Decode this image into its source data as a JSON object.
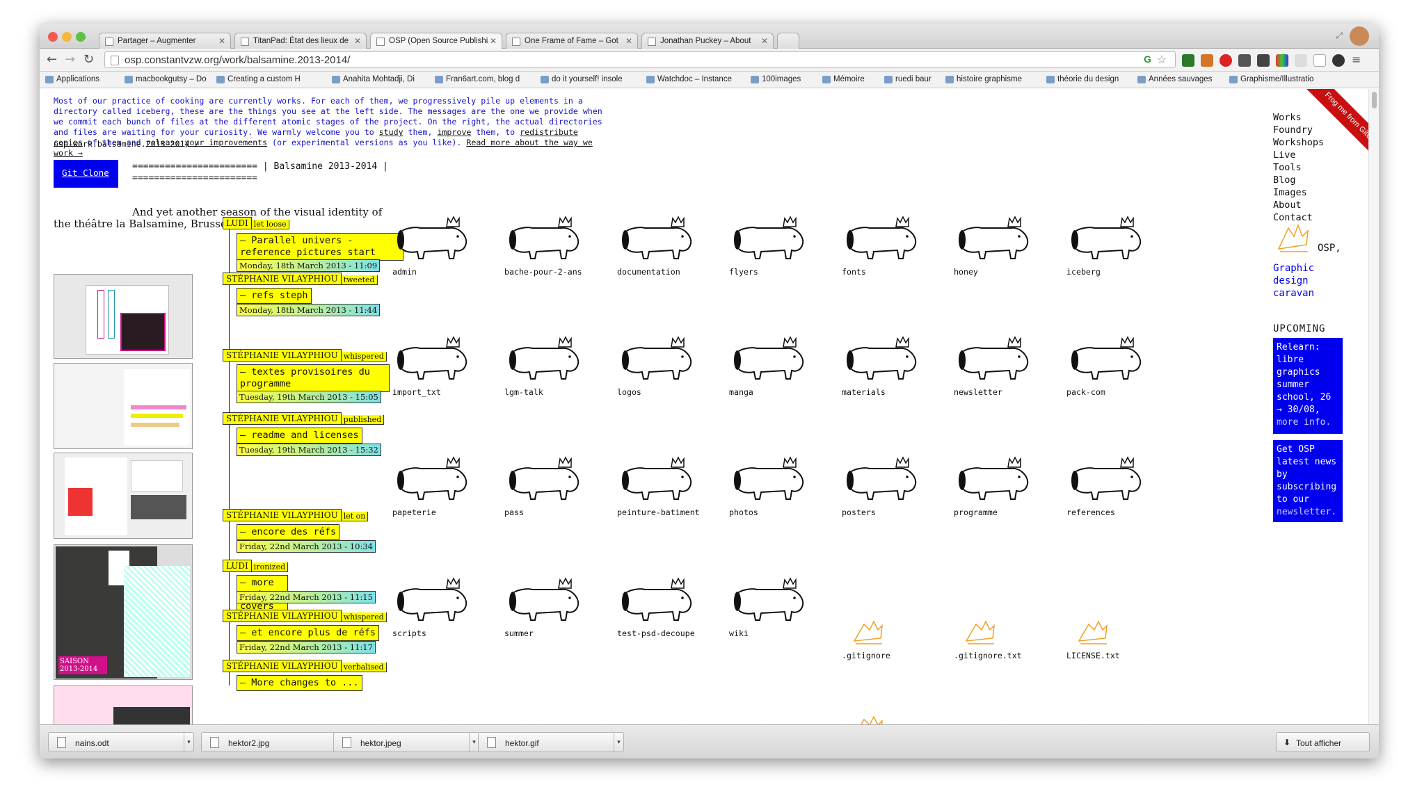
{
  "browser": {
    "tabs": [
      {
        "label": "Partager – Augmenter"
      },
      {
        "label": "TitanPad: État des lieux de"
      },
      {
        "label": "OSP (Open Source Publishi"
      },
      {
        "label": "One Frame of Fame – Got"
      },
      {
        "label": "Jonathan Puckey – About"
      }
    ],
    "url": "osp.constantvzw.org/work/balsamine.2013-2014/",
    "bookmarks": [
      "Applications",
      "macbookgutsy – Do",
      "Creating a custom H",
      "Anahita Mohtadji, Di",
      "Fran6art.com, blog d",
      "do it yourself! insole",
      "Watchdoc – Instance",
      "100images",
      "Mémoire",
      "ruedi baur",
      "histoire graphisme",
      "théorie du design",
      "Années sauvages",
      "Graphisme/Illustratio"
    ]
  },
  "page": {
    "intro_text": "Most of our practice of cooking are currently works. For each of them, we progressively pile up elements in a directory called iceberg, these are the things you see at the left side. The messages are the one we provide when we commit each bunch of files at the different atomic stages of the project. On the right, the actual directories and files are waiting for your curiosity. We warmly welcome you to",
    "link_study": "study",
    "link_improve": "improve",
    "link_redistribute": "redistribute copies",
    "link_release": "release your improvements",
    "intro_tail": "(or experimental versions as you like).",
    "read_more": "Read more about the way we work →",
    "breadcrumb": "osp.work.balsamine.2013-2014 /",
    "git_clone": "Git Clone",
    "rst_rule": "======================= | Balsamine 2013-2014 | =======================",
    "description": "And yet another season of the visual identity of the théâtre la Balsamine, Brussels."
  },
  "commits": [
    {
      "author": "LUDI",
      "action": "let loose",
      "message": "— Parallel univers - reference pictures start",
      "date": "Monday, 18th March 2013 - 11:09"
    },
    {
      "author": "STÉPHANIE VILAYPHIOU",
      "action": "tweeted",
      "message": "— refs steph",
      "date": "Monday, 18th March 2013 - 11:44"
    },
    {
      "author": "STÉPHANIE VILAYPHIOU",
      "action": "whispered",
      "message": "— textes provisoires du programme",
      "date": "Tuesday, 19th March 2013 - 15:05"
    },
    {
      "author": "STÉPHANIE VILAYPHIOU",
      "action": "published",
      "message": "— readme and licenses",
      "date": "Tuesday, 19th March 2013 - 15:32"
    },
    {
      "author": "STÉPHANIE VILAYPHIOU",
      "action": "let on",
      "message": "— encore des réfs",
      "date": "Friday, 22nd March 2013 - 10:34"
    },
    {
      "author": "LUDI",
      "action": "ironized",
      "message": "— more comics covers",
      "date": "Friday, 22nd March 2013 - 11:15"
    },
    {
      "author": "STÉPHANIE VILAYPHIOU",
      "action": "whispered",
      "message": "— et encore plus de réfs",
      "date": "Friday, 22nd March 2013 - 11:17"
    },
    {
      "author": "STÉPHANIE VILAYPHIOU",
      "action": "verbalised",
      "message": "— More changes to ...",
      "date": ""
    }
  ],
  "folders": [
    "admin",
    "bache-pour-2-ans",
    "documentation",
    "flyers",
    "fonts",
    "honey",
    "iceberg",
    "import_txt",
    "lgm-talk",
    "logos",
    "manga",
    "materials",
    "newsletter",
    "pack-com",
    "papeterie",
    "pass",
    "peinture-batiment",
    "photos",
    "posters",
    "programme",
    "references",
    "scripts",
    "summer",
    "test-psd-decoupe",
    "wiki"
  ],
  "files": [
    ".gitignore",
    ".gitignore.txt",
    "LICENSE.txt"
  ],
  "thumb_text": {
    "saison": "SAISON 2013-2014"
  },
  "nav": [
    "Works",
    "Foundry",
    "Workshops",
    "Live",
    "Tools",
    "Blog",
    "Images",
    "About",
    "Contact"
  ],
  "osp": {
    "name": "OSP,",
    "tagline": "Graphic design caravan"
  },
  "upcoming": {
    "title": "UPCOMING",
    "event": "Relearn: libre graphics summer school, 26 → 30/08,",
    "more": "more info.",
    "news": "Get OSP latest news by subscribing to our",
    "news_link": "newsletter."
  },
  "ribbon": "Frog me from GitOsp",
  "downloads": [
    "nains.odt",
    "hektor2.jpg",
    "hektor.jpeg",
    "hektor.gif"
  ],
  "show_all": "Tout afficher",
  "colors": {
    "link_blue": "#0000ee",
    "highlight_yellow": "#ffff00",
    "ribbon_red": "#c81010",
    "folder_orange": "#f0a020"
  }
}
